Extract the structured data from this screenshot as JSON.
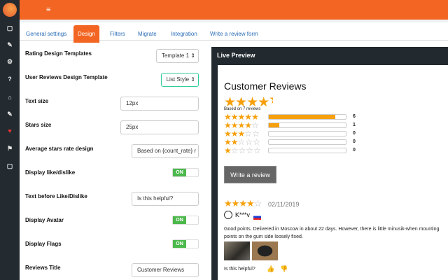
{
  "tabs": [
    "General settings",
    "Design",
    "Filters",
    "Migrate",
    "Integration",
    "Write a review form"
  ],
  "form": {
    "rating_templates": {
      "label": "Rating Design Templates",
      "value": "Template 1"
    },
    "user_reviews_template": {
      "label": "User Reviews Design Template",
      "value": "List Style"
    },
    "text_size": {
      "label": "Text size",
      "value": "12px"
    },
    "stars_size": {
      "label": "Stars size",
      "value": "25px"
    },
    "avg_design": {
      "label": "Average stars rate design",
      "value": "Based on {count_rate} r"
    },
    "like_dislike": {
      "label": "Display like/dislike",
      "state": "ON"
    },
    "text_before": {
      "label": "Text before Like/Dislike",
      "value": "Is this helpful?"
    },
    "avatar": {
      "label": "Display Avatar",
      "state": "ON"
    },
    "flags": {
      "label": "Display Flags",
      "state": "ON"
    },
    "reviews_title": {
      "label": "Reviews Title",
      "value": "Customer Reviews"
    }
  },
  "preview": {
    "header": "Live Preview",
    "title": "Customer Reviews",
    "avg_rating": 4.9,
    "based_on": "Based on 7 reviews",
    "distribution": [
      {
        "stars": 5,
        "count": "6",
        "fraction": 0.86
      },
      {
        "stars": 4,
        "count": "1",
        "fraction": 0.14
      },
      {
        "stars": 3,
        "count": "0",
        "fraction": 0
      },
      {
        "stars": 2,
        "count": "0",
        "fraction": 0
      },
      {
        "stars": 1,
        "count": "0",
        "fraction": 0
      }
    ],
    "write_button": "Write a review",
    "review": {
      "rating": 4,
      "date": "02/11/2019",
      "author": "K***v",
      "text": "Good points. Delivered in Moscow in about 22 days. However, there is little minusik-when mounting points on the gum side loosely fixed.",
      "helpful": "Is this helpful?"
    }
  },
  "colors": {
    "brand": "#f26522",
    "star": "#f5a00c",
    "toggle": "#4cb84c"
  }
}
